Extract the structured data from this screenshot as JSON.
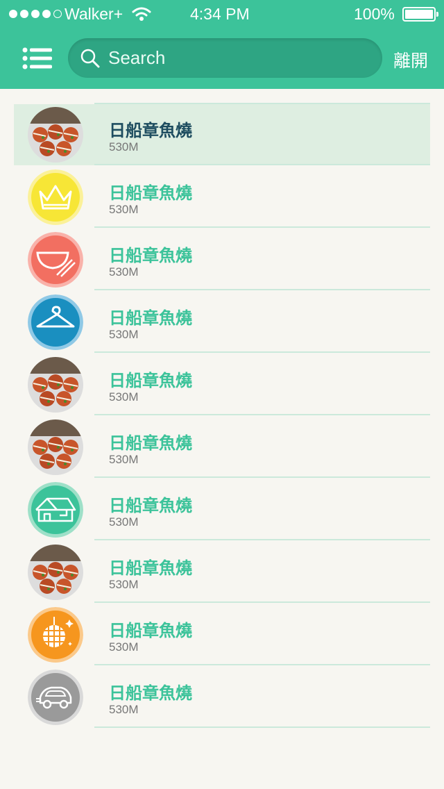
{
  "status_bar": {
    "carrier": "Walker+",
    "time": "4:34 PM",
    "battery_percent": "100%",
    "signal_bars_filled": 4,
    "signal_bars_total": 5
  },
  "header": {
    "menu_icon": "menu-list-icon",
    "search_placeholder": "Search",
    "leave_label": "離開",
    "accent_color": "#3cc39a"
  },
  "list": {
    "items": [
      {
        "title": "日船章魚燒",
        "distance": "530M",
        "icon": "takoyaki-photo",
        "selected": true
      },
      {
        "title": "日船章魚燒",
        "distance": "530M",
        "icon": "crown-icon",
        "color": "#f7e636"
      },
      {
        "title": "日船章魚燒",
        "distance": "530M",
        "icon": "bowl-chopsticks-icon",
        "color": "#f26f61"
      },
      {
        "title": "日船章魚燒",
        "distance": "530M",
        "icon": "hanger-icon",
        "color": "#1a8fc0"
      },
      {
        "title": "日船章魚燒",
        "distance": "530M",
        "icon": "takoyaki-photo"
      },
      {
        "title": "日船章魚燒",
        "distance": "530M",
        "icon": "takoyaki-photo"
      },
      {
        "title": "日船章魚燒",
        "distance": "530M",
        "icon": "house-icon",
        "color": "#3cc39a"
      },
      {
        "title": "日船章魚燒",
        "distance": "530M",
        "icon": "takoyaki-photo"
      },
      {
        "title": "日船章魚燒",
        "distance": "530M",
        "icon": "disco-ball-icon",
        "color": "#f6961e"
      },
      {
        "title": "日船章魚燒",
        "distance": "530M",
        "icon": "car-icon",
        "color": "#9a9a9a"
      }
    ]
  }
}
